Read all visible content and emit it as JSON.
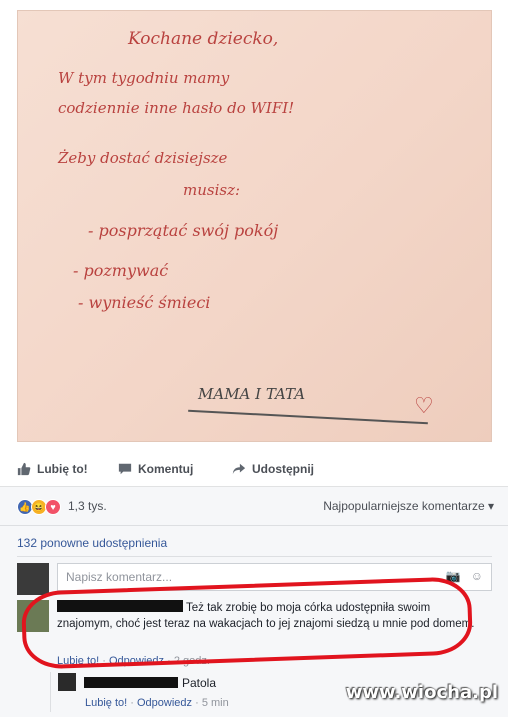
{
  "photo": {
    "lines": [
      "Kochane dziecko,",
      "W tym tygodniu mamy",
      "codziennie inne hasło do WIFI!",
      "Żeby dostać dzisiejsze",
      "musisz:",
      "- posprzątać swój pokój",
      "- pozmywać",
      "- wynieść śmieci",
      "MAMA I TATA"
    ]
  },
  "actions": {
    "like": "Lubię to!",
    "comment": "Komentuj",
    "share": "Udostępnij"
  },
  "reactions": {
    "count": "1,3 tys.",
    "sort": "Najpopularniejsze komentarze"
  },
  "shares": "132 ponowne udostępnienia",
  "composer": {
    "placeholder": "Napisz komentarz..."
  },
  "comment": {
    "text": "Też tak zrobię bo moja córka udostępniła swoim znajomym, choć jest teraz na wakacjach to jej znajomi siedzą u mnie pod domem.",
    "like": "Lubię to!",
    "reply": "Odpowiedz",
    "time": "2 godz."
  },
  "reply": {
    "name_suffix": "Patola",
    "like": "Lubię to!",
    "reply": "Odpowiedz",
    "time": "5 min"
  },
  "watermark": "www.wiocha.pl"
}
